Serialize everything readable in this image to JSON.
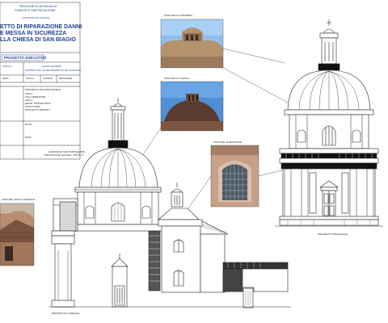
{
  "title_block": {
    "region": "REGIONE DI ACHIGALLE",
    "municipality": "COMUNE DI SAN PANTALEONE",
    "province": "PROVINCIA DI SAVONA",
    "project_title_lines": [
      "ETTO DI RIPARAZIONE DANNI",
      "E MESSA IN SICUREZZA",
      "LLA CHIESA DI SAN BIAGIO"
    ],
    "phase": "PROGETTO ESECUTIVO",
    "drawing_title": "ALZATI ESTERNI",
    "drawing_subtitle": "PROSPETTI DAL VIA DEI PROSPETTI E DAL SAN BIAGIO",
    "sheet_label": "TAVOLA",
    "fields": [
      "DATA",
      "SCALA",
      "CODICE",
      "REVISIONE"
    ],
    "staff_title": "PROGETTO ARCHITETTONICO",
    "staff_lines": [
      "ARCH.",
      "COLLABORATORI",
      "ARCH.",
      "GEOM. PROGETTISTA",
      "STRUTTURE",
      "PROGETTO IMPIANTI"
    ],
    "notes_label": "NOTE",
    "date_label": "DATA",
    "stamp_lines": [
      "COMUNE DI SAN PANTALEONE",
      "PROVINCIA DI SAVONA - PROT. N."
    ]
  },
  "photos": [
    {
      "name": "photo-lantern-top",
      "caption": "VISTA DELLA LANTERNA"
    },
    {
      "name": "photo-dome-close",
      "caption": "VISTA DELLA CUPOLA"
    },
    {
      "name": "photo-window",
      "caption": "VISTA DEL FINESTRONE"
    },
    {
      "name": "photo-roof-side",
      "caption": "VISTA DEL TETTO LATERALE"
    }
  ],
  "elevation_labels": {
    "right": "PROSPETTO PRINCIPALE",
    "bottom_left": "PROSPETTO LATERALE"
  },
  "colors": {
    "title_ink": "#1f3f96",
    "line": "#222222",
    "sky": "#7faee0",
    "stone": "#b89a7c",
    "brick": "#8a5a46"
  }
}
